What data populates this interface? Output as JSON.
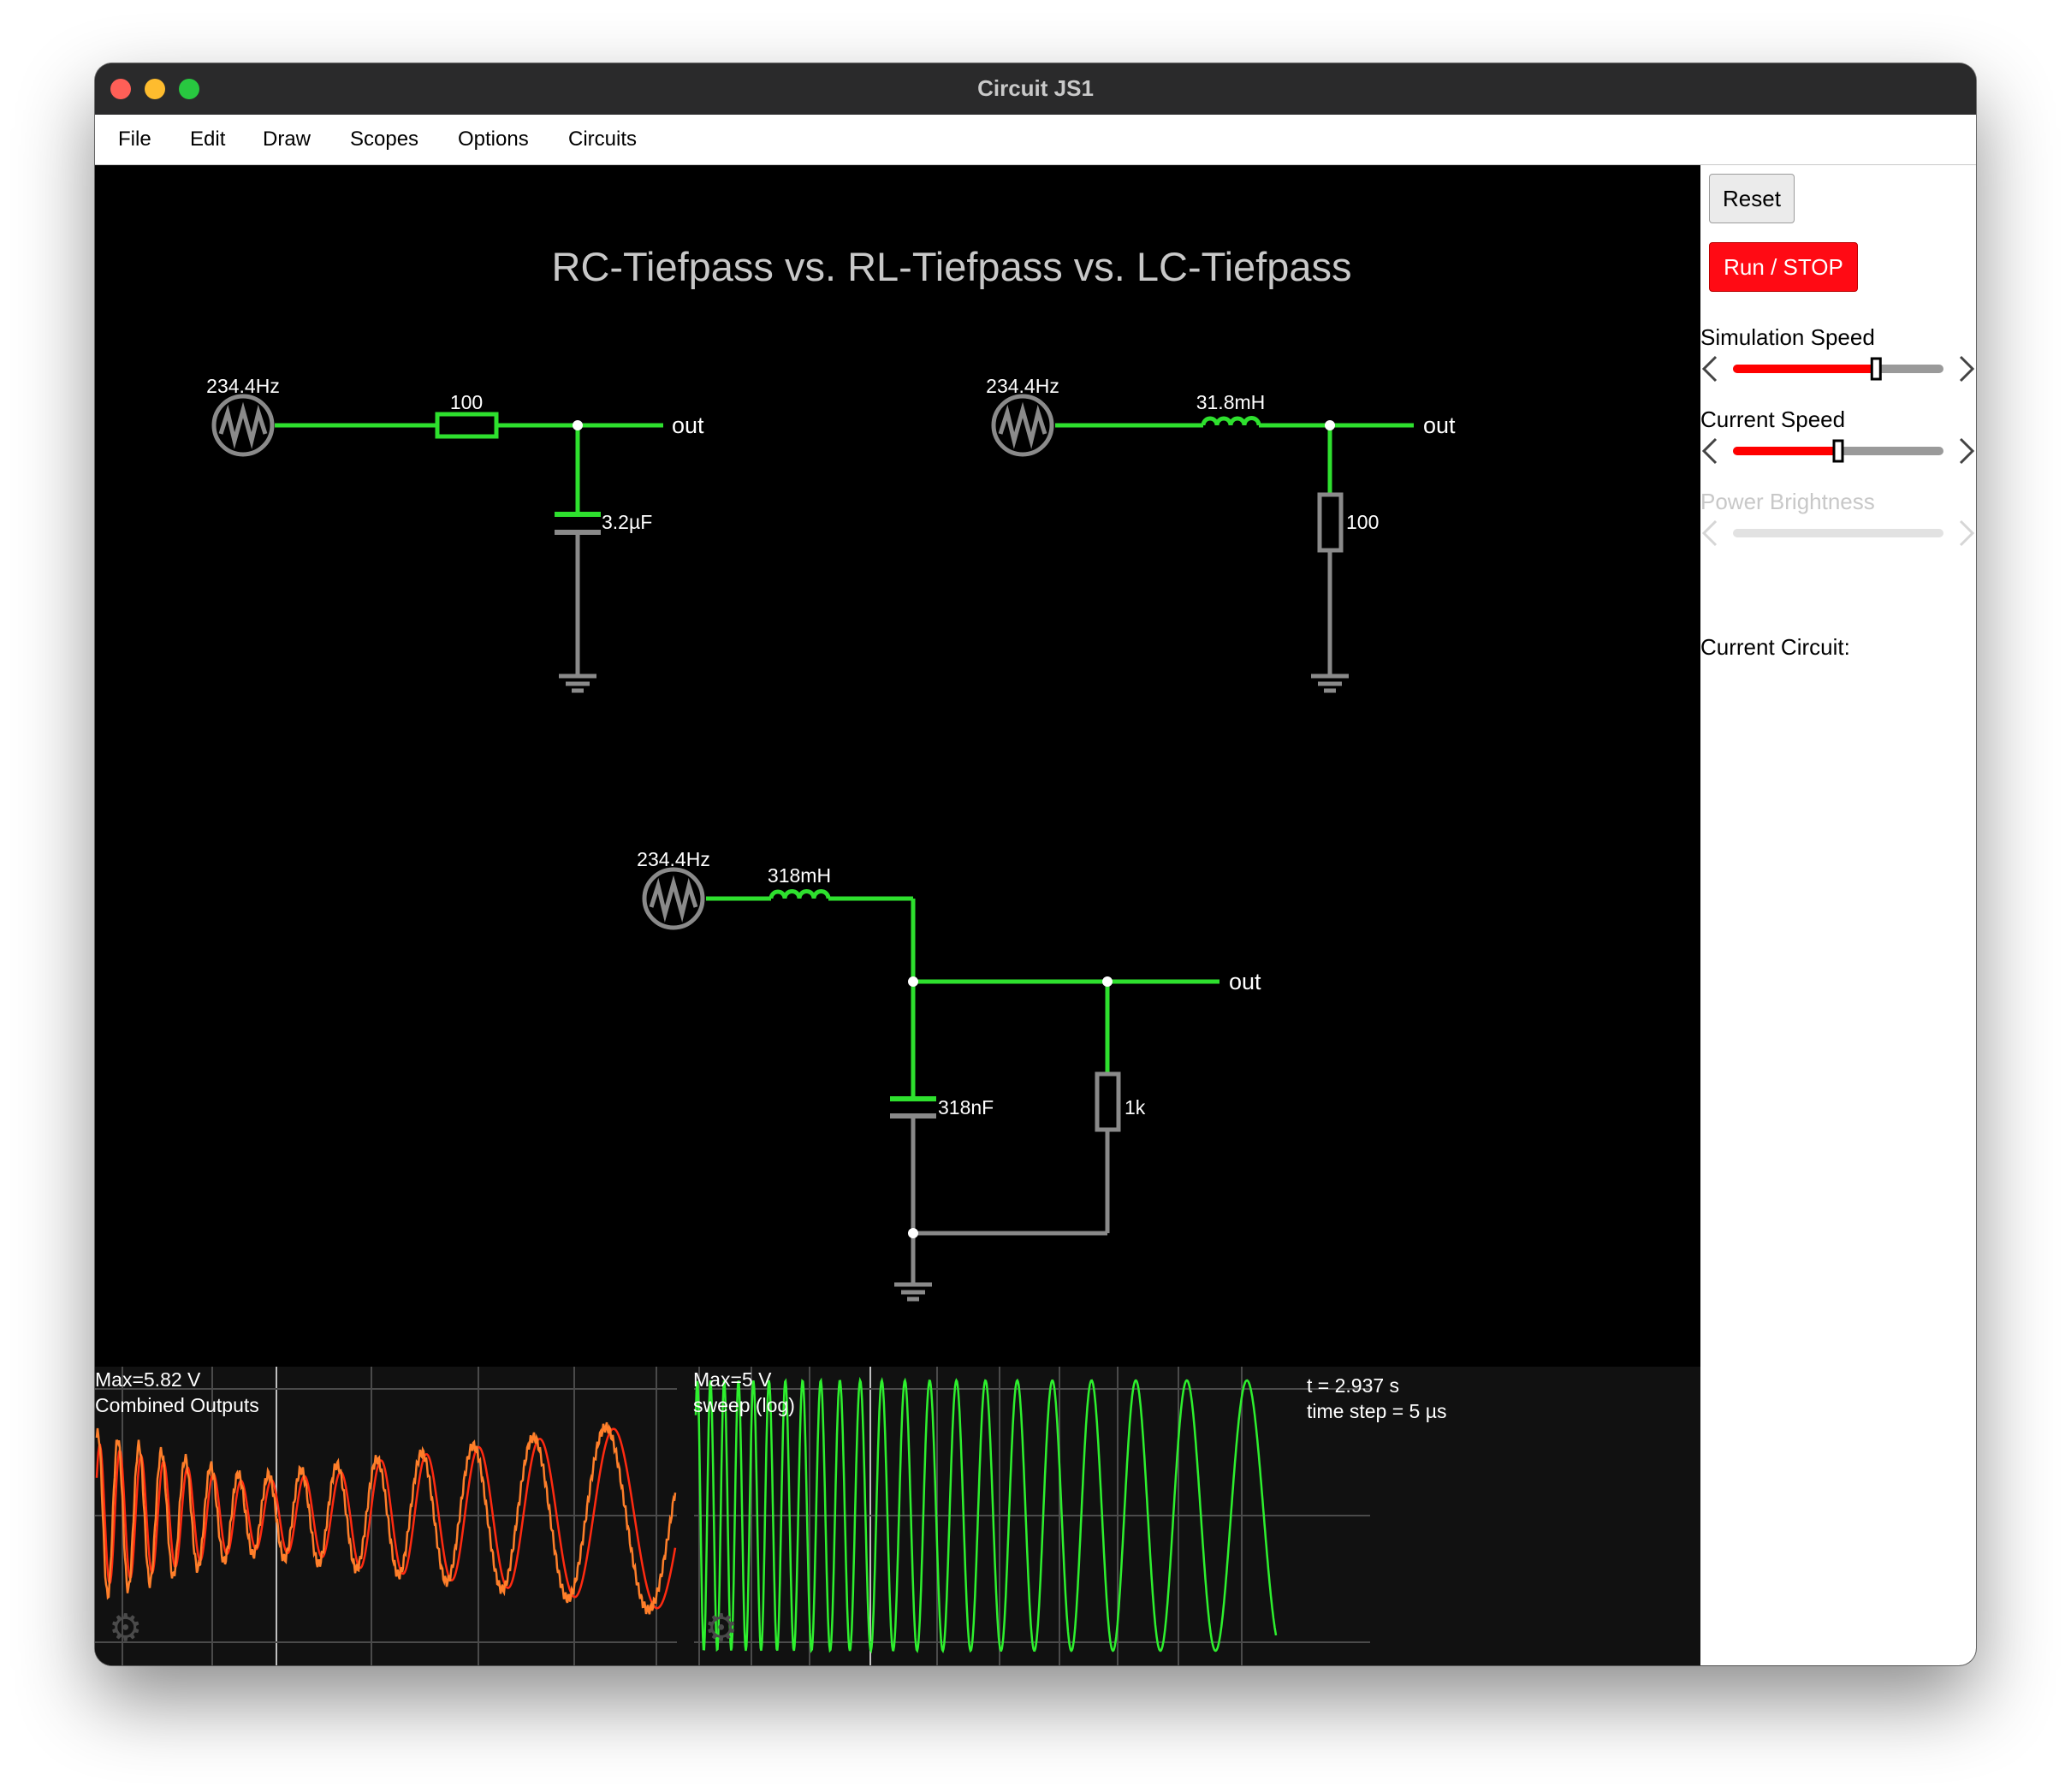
{
  "window": {
    "title": "Circuit JS1"
  },
  "menu": [
    "File",
    "Edit",
    "Draw",
    "Scopes",
    "Options",
    "Circuits"
  ],
  "circuit": {
    "heading": "RC-Tiefpass vs. RL-Tiefpass vs. LC-Tiefpass",
    "rc": {
      "source_label": "234.4Hz",
      "resistor_label": "100",
      "capacitor_label": "3.2µF",
      "out_label": "out"
    },
    "rl": {
      "source_label": "234.4Hz",
      "inductor_label": "31.8mH",
      "resistor_label": "100",
      "out_label": "out"
    },
    "lc": {
      "source_label": "234.4Hz",
      "inductor_label": "318mH",
      "capacitor_label": "318nF",
      "resistor_label": "1k",
      "out_label": "out"
    }
  },
  "scopes": {
    "left": {
      "max_label": "Max=5.82 V",
      "name": "Combined Outputs"
    },
    "right": {
      "max_label": "Max=5 V",
      "name": "sweep (log)"
    },
    "time": "t = 2.937 s",
    "timestep": "time step = 5 µs"
  },
  "sidebar": {
    "reset_label": "Reset",
    "run_stop_label": "Run / STOP",
    "simulation_speed_label": "Simulation Speed",
    "simulation_speed_level": 0.68,
    "current_speed_label": "Current Speed",
    "current_speed_level": 0.5,
    "power_brightness_label": "Power Brightness",
    "power_brightness_level": 0.0,
    "current_circuit_label": "Current Circuit:"
  },
  "colors": {
    "wire_active": "#2ee02e",
    "wire_idle": "#8a8a8a",
    "scope_orange": "#ff7f2a",
    "scope_red": "#ff2a10",
    "scope_green": "#2ef02e",
    "run_stop_bg": "#ff0a14"
  }
}
